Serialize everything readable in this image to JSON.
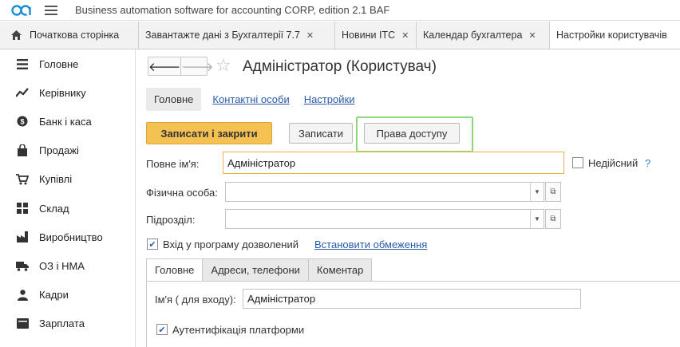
{
  "app": {
    "title": "Business automation software for accounting CORP, edition 2.1 BAF",
    "accent_color": "#1b8fd6"
  },
  "tabs": [
    {
      "label": "Початкова сторінка",
      "icon": "home-icon"
    },
    {
      "label": "Завантажте дані з Бухгалтерії 7.7",
      "close": "✕"
    },
    {
      "label": "Новини ІТС",
      "close": "✕"
    },
    {
      "label": "Календар бухгалтера",
      "close": "✕"
    },
    {
      "label": "Настройки користувачів"
    }
  ],
  "sidebar": {
    "items": [
      {
        "label": "Головне",
        "icon": "menu-lines-icon"
      },
      {
        "label": "Керівнику",
        "icon": "trend-icon"
      },
      {
        "label": "Банк і каса",
        "icon": "coin-icon"
      },
      {
        "label": "Продажі",
        "icon": "shopping-bag-icon"
      },
      {
        "label": "Купівлі",
        "icon": "cart-icon"
      },
      {
        "label": "Склад",
        "icon": "grid-icon"
      },
      {
        "label": "Виробництво",
        "icon": "factory-icon"
      },
      {
        "label": "ОЗ і НМА",
        "icon": "truck-icon"
      },
      {
        "label": "Кадри",
        "icon": "person-icon"
      },
      {
        "label": "Зарплата",
        "icon": "wallet-icon"
      }
    ]
  },
  "form": {
    "title": "Адміністратор (Користувач)",
    "subtabs": {
      "main": "Головне",
      "contacts": "Контактні особи",
      "settings": "Настройки"
    },
    "buttons": {
      "save_close": "Записати і закрити",
      "save": "Записати",
      "rights": "Права доступу"
    },
    "full_name": {
      "label": "Повне ім'я:",
      "value": "Адміністратор"
    },
    "invalid": {
      "label": "Недійсний",
      "checked": false,
      "help": "?"
    },
    "person": {
      "label": "Фізична особа:",
      "value": ""
    },
    "department": {
      "label": "Підрозділ:",
      "value": ""
    },
    "login_allowed": {
      "label": "Вхід у програму дозволений",
      "checked": true,
      "link": "Встановити обмеження"
    },
    "inner_tabs": [
      "Головне",
      "Адреси, телефони",
      "Коментар"
    ],
    "login_name": {
      "label": "Ім'я ( для входу):",
      "value": "Адміністратор"
    },
    "platform_auth": {
      "label": "Аутентифікація платформи",
      "checked": true
    }
  }
}
